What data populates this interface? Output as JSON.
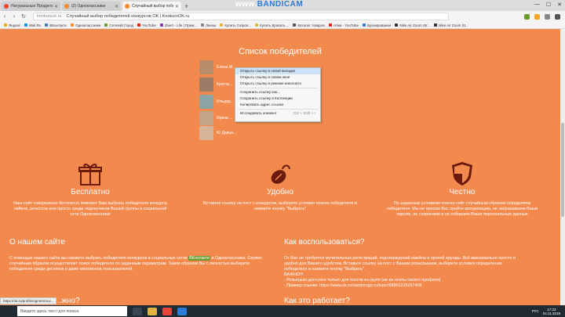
{
  "browser": {
    "tabs": [
      {
        "title": "Натуральные Продукты -",
        "color": "#e9463b"
      },
      {
        "title": "(2) Одноклассники",
        "color": "#f28a2e"
      },
      {
        "title": "Случайный выбор побе...",
        "color": "#f28a2e",
        "active": true
      }
    ],
    "recorder": {
      "main": "www.",
      "brand": "BANDICAM",
      ".com": ".com"
    },
    "address": {
      "host": "konkursok.ru",
      "title": "Случайный выбор победителей конкурсов OK | KonkursOK.ru"
    },
    "bookmarks": [
      "Яндекс",
      "Mail.Ru",
      "ВКонтакте",
      "Одноклассники",
      "Сетевой Город",
      "YouTube",
      "Zivert - Life | Прем...",
      "Линзы",
      "Купить Гопрол...",
      "Купить Кровать ...",
      "Каталог товаров",
      "Атма - YouTube",
      "Бронирование",
      "Nike Air Zoom Str...",
      "Nike Air Zoom St..."
    ]
  },
  "winners": {
    "title": "Список победителей",
    "items": [
      "Елена М...",
      "Кристи...",
      "Ильдар...",
      "Ирина ...",
      "Ю Дарьи..."
    ]
  },
  "context_menu": {
    "items": [
      {
        "label": "Открыть ссылку в новой вкладке",
        "highlight": true
      },
      {
        "label": "Открыть ссылку в новом окне"
      },
      {
        "label": "Открыть ссылку в режиме инкогнито"
      },
      {
        "sep": true
      },
      {
        "label": "Сохранить ссылку как..."
      },
      {
        "label": "Сохранить ссылку в Коллекции"
      },
      {
        "label": "Копировать адрес ссылки"
      },
      {
        "sep": true
      },
      {
        "label": "Исследовать элемент",
        "shortcut": "Ctrl + Shift + I"
      }
    ]
  },
  "features": [
    {
      "title": "Бесплатно",
      "icon": "gift-icon",
      "text": "Наш сайт совершенно бесплатно поможет Вам выбрать победителя конкурса лайков, репостов или просто среди подписчиков Вашей группы в социальной сети Одноклассники"
    },
    {
      "title": "Удобно",
      "icon": "mouse-icon",
      "text": "Вставьте ссылку на пост с конкурсом, выберите условия поиска победителя и нажмите кнопку \"Выбрать\""
    },
    {
      "title": "Честно",
      "icon": "shield-icon",
      "text": "По заданным условиям поиска сайт случайным образом определяем победителя. Мы не просим Вас пройти авторизацию, не запрашиваем Ваши пароли, не сохраняем и не собираем Ваши персональные данные"
    }
  ],
  "about": {
    "title": "О нашем сайте",
    "text_before": "С помощью нашего сайта вы сможете выбрать победителя конкурсов в социальных сетях ",
    "link": "ВКонтакте",
    "text_after": " и Одноклассники. Сервис случайным образом осуществляет поиск победителя по заданным параметрам. Таким образом Вы с легкостью выберете победителя среди десятков и даже миллионов пользователей."
  },
  "howto": {
    "title": "Как воспользоваться?",
    "text": "От Вас не требуется мучительных регистраций, подтверждений емейла и прочей ерунды. Всё максимально просто и удобно для Вашего удобства. Вставьте ссылку на пост с Вашим розыгрышем, выберите условия определения победителя и нажмите кнопку \"Выбрать\".",
    "important": "ВАЖНО!!!",
    "note1": "- Розыгрыш доступен только для постов из групп (не из ленты своего профиля)",
    "note2": "- Пример ссылки: https://www.ok.ru/vsedorogo.ru/topic/68801225267406"
  },
  "cut_headers": {
    "left": "...жно?",
    "right": "Как это работает?"
  },
  "status_url": "https://ok.ru/profile/ogmenrnov...",
  "taskbar": {
    "search_placeholder": "Введите здесь текст для поиска",
    "lang": "РУС",
    "time": "17:23",
    "date": "04.11.2019"
  },
  "colors": {
    "page": "#f28a4e",
    "menu_highlight": "#cfe3f7",
    "link": "#6c9b2d",
    "icon_dark": "#6b1a0d"
  }
}
